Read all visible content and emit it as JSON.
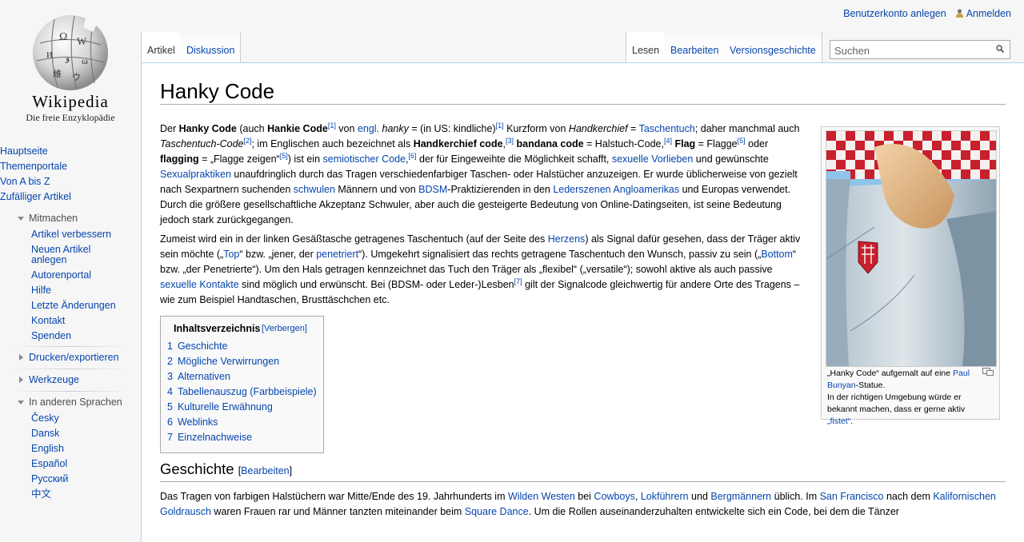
{
  "logo": {
    "wordmark": "Wikipedia",
    "tagline": "Die freie Enzyklopädie"
  },
  "personal": {
    "create_account": "Benutzerkonto anlegen",
    "login": "Anmelden"
  },
  "tabs": {
    "article": "Artikel",
    "discussion": "Diskussion",
    "read": "Lesen",
    "edit": "Bearbeiten",
    "history": "Versionsgeschichte"
  },
  "search": {
    "placeholder": "Suchen"
  },
  "sidebar": {
    "main": [
      "Hauptseite",
      "Themenportale",
      "Von A bis Z",
      "Zufälliger Artikel"
    ],
    "participate_heading": "Mitmachen",
    "participate": [
      "Artikel verbessern",
      "Neuen Artikel anlegen",
      "Autorenportal",
      "Hilfe",
      "Letzte Änderungen",
      "Kontakt",
      "Spenden"
    ],
    "print_heading": "Drucken/exportieren",
    "tools_heading": "Werkzeuge",
    "languages_heading": "In anderen Sprachen",
    "languages": [
      "Česky",
      "Dansk",
      "English",
      "Español",
      "Русский",
      "中文"
    ]
  },
  "article": {
    "title": "Hanky Code",
    "p1": {
      "t1": "Der ",
      "b1": "Hanky Code",
      "t2": " (auch ",
      "b2": "Hankie Code",
      "s1": "[1]",
      "t3": " von ",
      "l1": "engl.",
      "t4": " ",
      "i1": "hanky",
      "t5": " = (in US: kindliche)",
      "s2": "[1]",
      "t6": " Kurzform von ",
      "i2": "Handkerchief",
      "t7": " = ",
      "l2": "Taschentuch",
      "t8": "; daher manchmal auch ",
      "i3": "Taschentuch-Code",
      "s3": "[2]",
      "t9": "; im Englischen auch bezeichnet als ",
      "b3": "Handkerchief code",
      "t10": ",",
      "s4": "[3]",
      "t11": " ",
      "b4": "bandana code",
      "t12": " = Halstuch-Code,",
      "s5": "[4]",
      "t13": " ",
      "b5": "Flag",
      "t14": " = Flagge",
      "s6": "[5]",
      "t15": " oder ",
      "b6": "flagging",
      "t16": " = „Flagge zeigen“",
      "s7": "[5]",
      "t17": ") ist ein ",
      "l3": "semiotischer Code",
      "t18": ",",
      "s8": "[6]",
      "t19": " der für Eingeweihte die Möglichkeit schafft, ",
      "l4": "sexuelle Vorlieben",
      "t20": " und gewünschte ",
      "l5": "Sexualpraktiken",
      "t21": " unaufdringlich durch das Tragen verschiedenfarbiger Taschen- oder Halstücher anzuzeigen. Er wurde üblicherweise von gezielt nach Sexpartnern suchenden ",
      "l6": "schwulen",
      "t22": " Männern und von ",
      "l7": "BDSM",
      "t23": "-Praktizierenden in den ",
      "l8": "Lederszenen",
      "t24": " ",
      "l9": "Angloamerikas",
      "t25": " und Europas verwendet. Durch die größere gesellschaftliche Akzeptanz Schwuler, aber auch die gesteigerte Bedeutung von Online-Datingseiten, ist seine Bedeutung jedoch stark zurückgegangen."
    },
    "p2": {
      "t1": "Zumeist wird ein in der linken Gesäßtasche getragenes Taschentuch (auf der Seite des ",
      "l1": "Herzens",
      "t2": ") als Signal dafür gesehen, dass der Träger aktiv sein möchte („",
      "l2": "Top",
      "t3": "“ bzw. „jener, der ",
      "l3": "penetriert",
      "t4": "“). Umgekehrt signalisiert das rechts getragene Taschentuch den Wunsch, passiv zu sein („",
      "l4": "Bottom",
      "t5": "“ bzw. „der Penetrierte“). Um den Hals getragen kennzeichnet das Tuch den Träger als „flexibel“ („versatile“); sowohl aktive als auch passive ",
      "l5": "sexuelle Kontakte",
      "t6": " sind möglich und erwünscht. Bei (BDSM- oder Leder-)Lesben",
      "s1": "[7]",
      "t7": " gilt der Signalcode gleichwertig für andere Orte des Tragens – wie zum Beispiel Handtaschen, Brusttäschchen etc."
    },
    "toc": {
      "title": "Inhaltsverzeichnis",
      "toggle": "[Verbergen]",
      "items": [
        {
          "num": "1",
          "label": "Geschichte"
        },
        {
          "num": "2",
          "label": "Mögliche Verwirrungen"
        },
        {
          "num": "3",
          "label": "Alternativen"
        },
        {
          "num": "4",
          "label": "Tabellenauszug (Farbbeispiele)"
        },
        {
          "num": "5",
          "label": "Kulturelle Erwähnung"
        },
        {
          "num": "6",
          "label": "Weblinks"
        },
        {
          "num": "7",
          "label": "Einzelnachweise"
        }
      ]
    },
    "thumb": {
      "c1": "„Hanky Code“ aufgemalt auf eine ",
      "l1": "Paul Bunyan",
      "c2": "-Statue.",
      "c3": "In der richtigen Umgebung würde er bekannt machen, dass er gerne aktiv ",
      "l2": "„fistet“",
      "c4": "."
    },
    "section_title": "Geschichte",
    "section_edit": "Bearbeiten",
    "p3": {
      "t1": "Das Tragen von farbigen Halstüchern war Mitte/Ende des 19. Jahrhunderts im ",
      "l1": "Wilden Westen",
      "t2": " bei ",
      "l2": "Cowboys",
      "t3": ", ",
      "l3": "Lokführern",
      "t4": " und ",
      "l4": "Bergmännern",
      "t5": " üblich. Im ",
      "l5": "San Francisco",
      "t6": " nach dem ",
      "l6": "Kalifornischen Goldrausch",
      "t7": " waren Frauen rar und Männer tanzten miteinander beim ",
      "l7": "Square Dance",
      "t8": ". Um die Rollen auseinanderzuhalten entwickelte sich ein Code, bei dem die Tänzer"
    }
  }
}
